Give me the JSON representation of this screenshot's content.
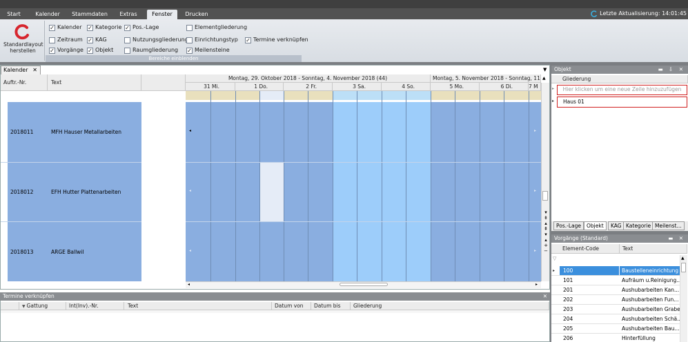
{
  "ribbon_tabs": [
    "Start",
    "Kalender",
    "Stammdaten",
    "Extras",
    "Fenster",
    "Drucken"
  ],
  "active_tab": "Fenster",
  "last_update": "Letzte Aktualisierung: 14:01:45",
  "std_button": "Standardlayout herstellen",
  "group_label": "Bereiche einblenden",
  "checkboxes": [
    {
      "label": "Kalender",
      "checked": true
    },
    {
      "label": "Zeitraum",
      "checked": false
    },
    {
      "label": "Vorgänge",
      "checked": true
    },
    {
      "label": "Kategorie",
      "checked": true
    },
    {
      "label": "KAG",
      "checked": true
    },
    {
      "label": "Objekt",
      "checked": true
    },
    {
      "label": "Pos.-Lage",
      "checked": true
    },
    {
      "label": "Nutzungsgliederung",
      "checked": false
    },
    {
      "label": "Raumgliederung",
      "checked": false
    },
    {
      "label": "Elementgliederung",
      "checked": false
    },
    {
      "label": "Einrichtungstyp",
      "checked": false
    },
    {
      "label": "Meilensteine",
      "checked": true
    },
    {
      "label": "Termine verknüpfen",
      "checked": true
    }
  ],
  "doc_tab": "Kalender",
  "columns": {
    "auftr": "Auftr.-Nr.",
    "text": "Text"
  },
  "week1": "Montag, 29. Oktober 2018 - Sonntag, 4. November 2018 (44)",
  "week2": "Montag, 5. November 2018 - Sonntag, 11. No",
  "days": [
    "31 Mi.",
    "1 Do.",
    "2 Fr.",
    "3 Sa.",
    "4 So.",
    "5 Mo.",
    "6 Di.",
    "7 M"
  ],
  "rows": [
    {
      "nr": "2018011",
      "text": "MFH Hauser Metallarbeiten"
    },
    {
      "nr": "2018012",
      "text": "EFH Hutter Plattenarbeiten"
    },
    {
      "nr": "2018013",
      "text": "ARGE Ballwil"
    }
  ],
  "bottom": {
    "title": "Termine verknüpfen",
    "cols": [
      "Gattung",
      "Int(Inv).-Nr.",
      "Text",
      "Datum von",
      "Datum bis",
      "Gliederung"
    ]
  },
  "objekt": {
    "title": "Objekt",
    "col": "Gliederung",
    "newrow": "Hier klicken um eine neue Zeile hinzuzufügen",
    "item": "Haus 01"
  },
  "rp_tabs": [
    "Pos.-Lage",
    "Objekt",
    "KAG",
    "Kategorie",
    "Meilenst..."
  ],
  "vorgaenge": {
    "title": "Vorgänge (Standard)",
    "cols": [
      "Element-Code",
      "Text"
    ],
    "rows": [
      {
        "code": "100",
        "text": "Baustelleneinrichtung"
      },
      {
        "code": "101",
        "text": "Aufräum u.Reinigung..."
      },
      {
        "code": "201",
        "text": "Aushubarbeiten Kan..."
      },
      {
        "code": "202",
        "text": "Aushubarbeiten Fun..."
      },
      {
        "code": "203",
        "text": "Aushubarbeiten Graben"
      },
      {
        "code": "204",
        "text": "Aushubarbeiten Schä..."
      },
      {
        "code": "205",
        "text": "Aushubarbeiten Bau..."
      },
      {
        "code": "206",
        "text": "Hinterfüllung"
      }
    ]
  }
}
